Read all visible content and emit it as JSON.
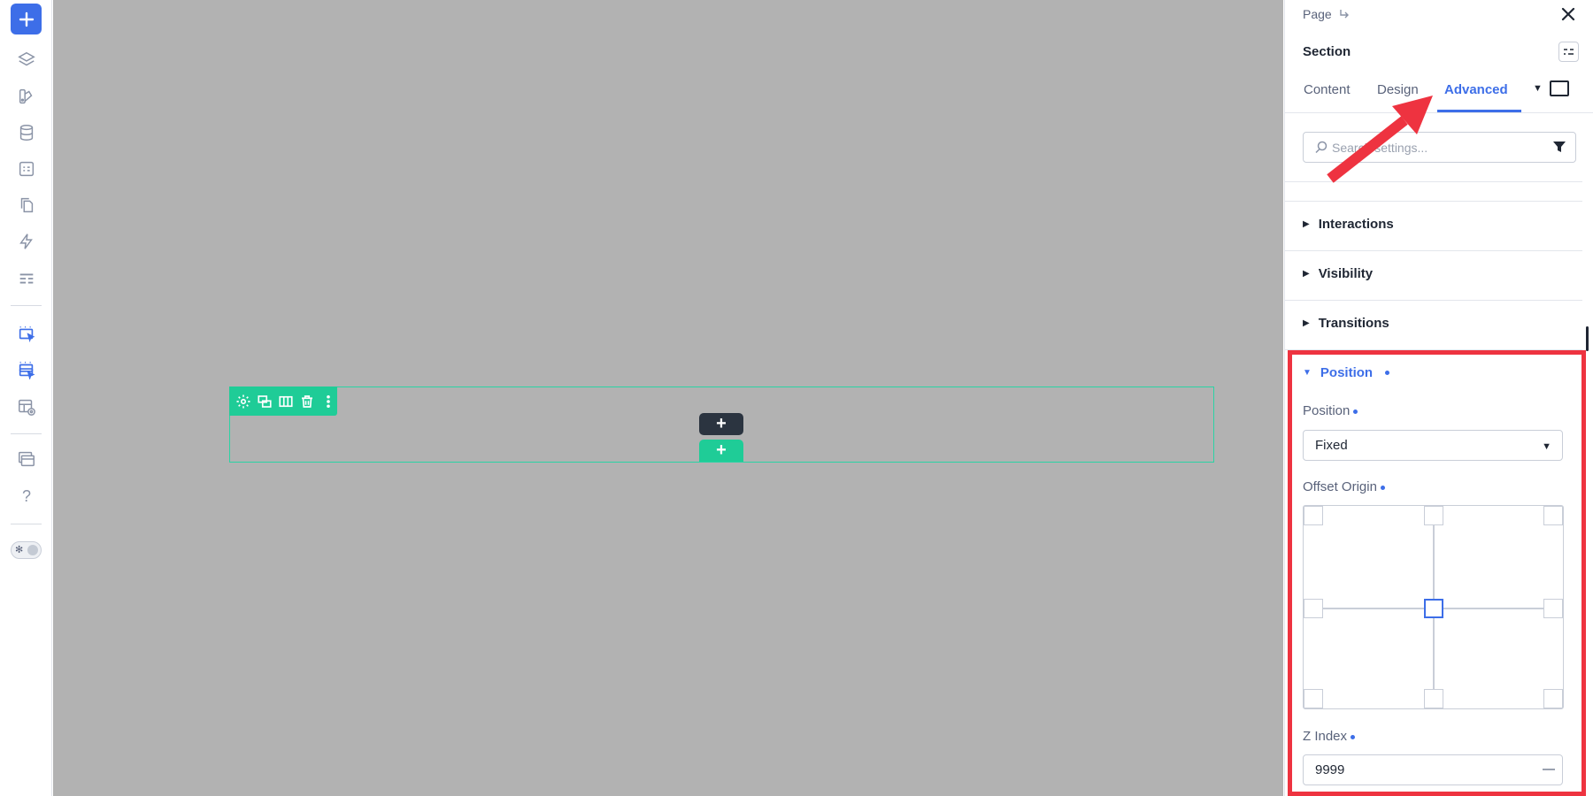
{
  "panel": {
    "breadcrumb": "Page",
    "section_title": "Section",
    "tabs": [
      "Content",
      "Design",
      "Advanced"
    ],
    "active_tab": "Advanced",
    "search_placeholder": "Search settings...",
    "accordions": {
      "interactions": "Interactions",
      "visibility": "Visibility",
      "transitions": "Transitions",
      "position": "Position"
    },
    "position_label": "Position",
    "position_value": "Fixed",
    "offset_origin_label": "Offset Origin",
    "offset_origin_selected": "center",
    "z_index_label": "Z Index",
    "z_index_value": "9999"
  },
  "canvas": {
    "add_buttons": [
      "+",
      "+"
    ]
  },
  "colors": {
    "accent": "#3d6ee8",
    "section_green": "#1fcc97",
    "canvas_bg": "#b2b2b2",
    "annotation_red": "#ee3340"
  },
  "icons": {
    "left_toolbar": [
      "plus-icon",
      "layers-icon",
      "theme-icon",
      "database-icon",
      "forms-icon",
      "pages-icon",
      "lightning-icon",
      "layout-icon",
      "select-element-icon",
      "select-multiple-icon",
      "preview-layout-icon",
      "windows-icon",
      "help-icon",
      "theme-toggle"
    ],
    "section_toolbar": [
      "gear-icon",
      "duplicate-icon",
      "columns-icon",
      "trash-icon",
      "more-vertical-icon"
    ]
  }
}
